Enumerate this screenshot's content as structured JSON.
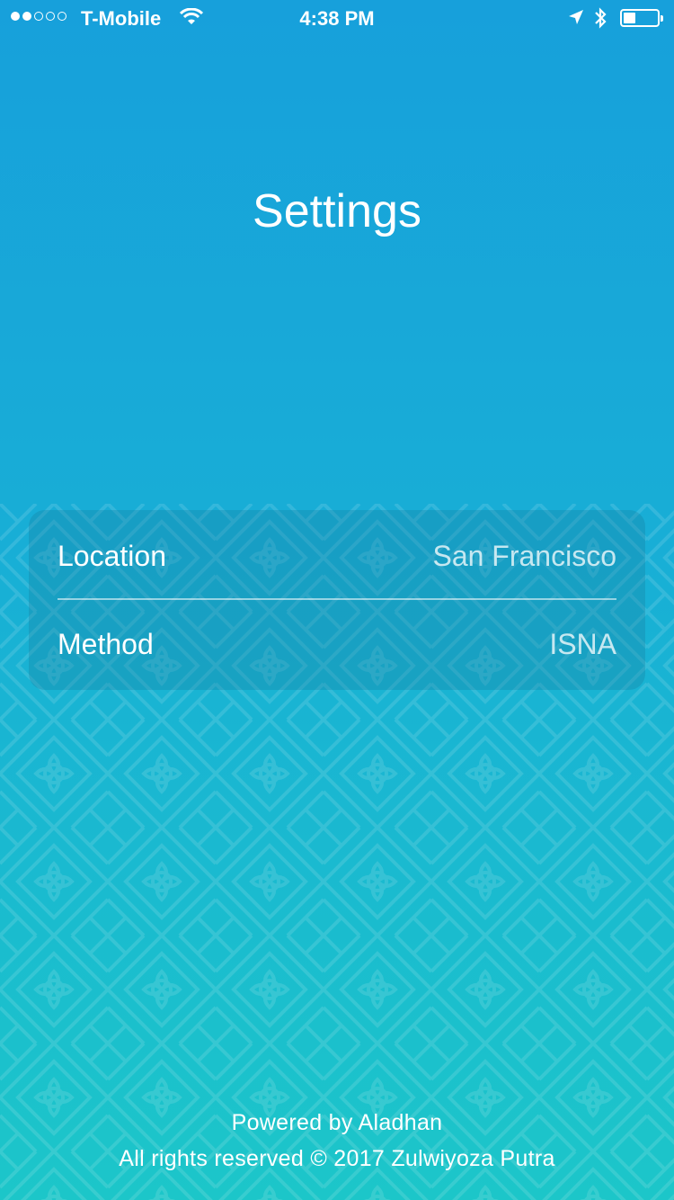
{
  "status_bar": {
    "carrier": "T-Mobile",
    "time": "4:38 PM",
    "signal_bars_filled": 2,
    "signal_bars_total": 5,
    "battery_level": 0.35,
    "icons": [
      "wifi-icon",
      "location-arrow-icon",
      "bluetooth-icon",
      "battery-icon"
    ]
  },
  "header": {
    "title": "Settings"
  },
  "settings": {
    "rows": [
      {
        "label": "Location",
        "value": "San Francisco"
      },
      {
        "label": "Method",
        "value": "ISNA"
      }
    ]
  },
  "footer": {
    "powered_by": "Powered by Aladhan",
    "copyright": "All rights reserved © 2017 Zulwiyoza Putra"
  },
  "colors": {
    "gradient_top": "#17a0db",
    "gradient_bottom": "#1cc6c9",
    "text": "#ffffff"
  }
}
